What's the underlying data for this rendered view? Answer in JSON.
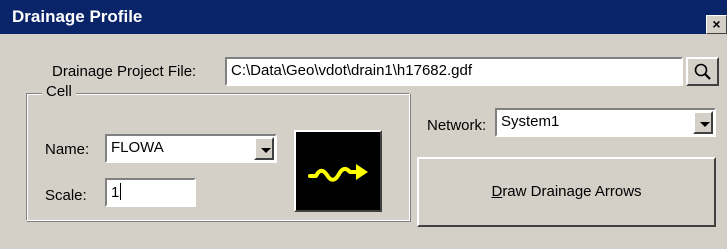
{
  "window": {
    "title": "Drainage Profile",
    "close_glyph": "×"
  },
  "project": {
    "label": "Drainage Project File:",
    "value": "C:\\Data\\Geo\\vdot\\drain1\\h17682.gdf",
    "browse_icon": "magnifier-icon"
  },
  "cell": {
    "group_label": "Cell",
    "name_label": "Name:",
    "name_value": "FLOWA",
    "scale_label": "Scale:",
    "scale_value": "1",
    "preview_icon": "wavy-arrow-icon",
    "preview_color": "#ffff00"
  },
  "network": {
    "label": "Network:",
    "value": "System1"
  },
  "actions": {
    "draw_first_letter": "D",
    "draw_rest": "raw Drainage Arrows"
  },
  "colors": {
    "titlebar": "#0a246a",
    "face": "#d4d0c8"
  }
}
